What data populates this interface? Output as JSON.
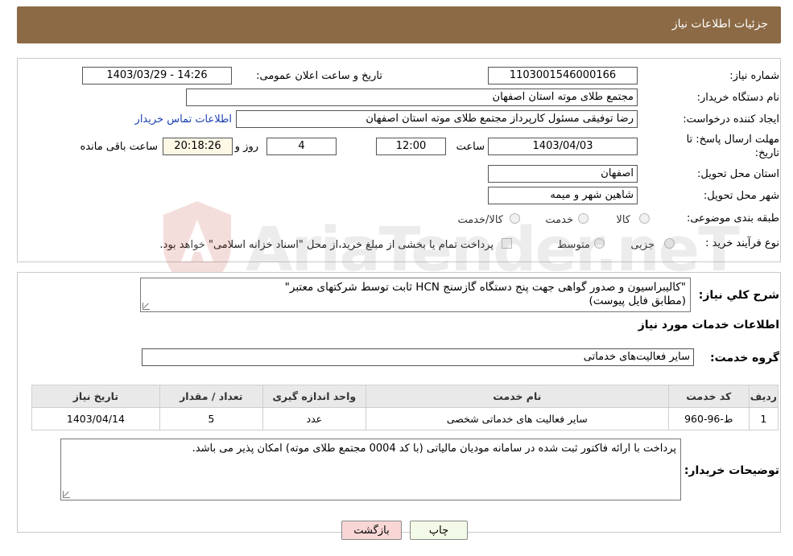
{
  "header": {
    "title": "جزئیات اطلاعات نیاز"
  },
  "form": {
    "need_number_label": "شماره نیاز:",
    "need_number": "1103001546000166",
    "announce_label": "تاریخ و ساعت اعلان عمومی:",
    "announce_value": "1403/03/29 - 14:26",
    "buyer_label": "نام دستگاه خریدار:",
    "buyer_value": "مجتمع طلای موته استان اصفهان",
    "creator_label": "ایجاد کننده درخواست:",
    "creator_value": "رضا توفیقی مسئول کارپرداز مجتمع طلای موته استان اصفهان",
    "contact_link": "اطلاعات تماس خریدار",
    "deadline_label_1": "مهلت ارسال پاسخ: تا",
    "deadline_label_2": "تاریخ:",
    "deadline_date": "1403/04/03",
    "time_label": "ساعت",
    "deadline_time": "12:00",
    "days_value": "4",
    "days_label": "روز و",
    "remaining_time": "20:18:26",
    "remaining_label": "ساعت باقی مانده",
    "province_label": "استان محل تحویل:",
    "province_value": "اصفهان",
    "city_label": "شهر محل تحویل:",
    "city_value": "شاهین شهر و میمه",
    "category_label": "طبقه بندی موضوعی:",
    "category_options": [
      "کالا",
      "خدمت",
      "کالا/خدمت"
    ],
    "process_label": "نوع فرآیند خرید :",
    "process_options": [
      "جزیی",
      "متوسط"
    ],
    "payment_note": "پرداخت تمام یا بخشی از مبلغ خرید،از محل \"اسناد خزانه اسلامی\" خواهد بود."
  },
  "summary": {
    "label": "شرح کلي نياز:",
    "text_line1": "\"کالیبراسیون و صدور گواهی جهت پنج دستگاه گازسنج  HCN ثابت توسط شرکتهای معتبر\"",
    "text_line2": "(مطابق فایل پیوست)"
  },
  "services": {
    "section_title": "اطلاعات خدمات مورد نیاز",
    "group_label": "گروه خدمت:",
    "group_value": "سایر فعالیت‌های خدماتی",
    "columns": [
      "ردیف",
      "کد خدمت",
      "نام خدمت",
      "واحد اندازه گیری",
      "تعداد / مقدار",
      "تاریخ نیاز"
    ],
    "rows": [
      [
        "1",
        "ط-96-960",
        "سایر فعالیت های خدماتی شخصی",
        "عدد",
        "5",
        "1403/04/14"
      ]
    ]
  },
  "buyer_notes": {
    "label": "توضیحات خریدار:",
    "text": "پرداخت با ارائه فاکتور ثبت شده در سامانه مودیان مالیاتی (با کد 0004 مجتمع طلای موته) امکان پذیر می باشد."
  },
  "buttons": {
    "print": "چاپ",
    "back": "بازگشت"
  },
  "colors": {
    "header_bg": "#8b6a45",
    "link": "#1a3fb3",
    "back_btn": "#f9d6d6",
    "print_btn": "#f2f9e6"
  }
}
